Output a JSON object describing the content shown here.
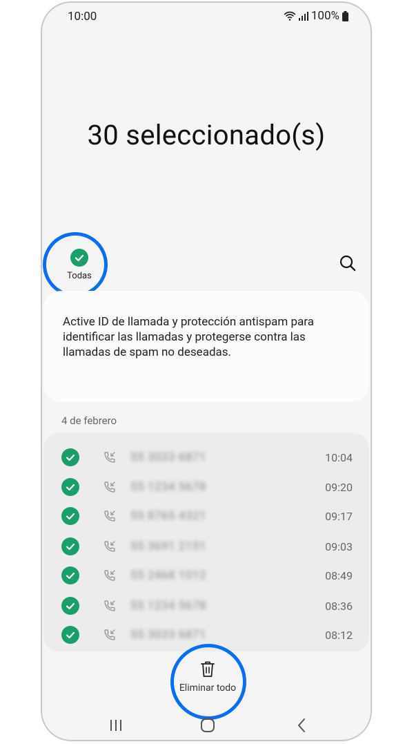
{
  "status_bar": {
    "time": "10:00",
    "battery": "100%"
  },
  "header": {
    "title": "30 seleccionado(s)"
  },
  "toolbar": {
    "select_all_label": "Todas"
  },
  "info_card": {
    "text": "Active ID de llamada y protección antispam para identificar las llamadas y protegerse contra las llamadas de spam no deseadas."
  },
  "call_log": {
    "date_header": "4 de febrero",
    "rows": [
      {
        "number": "55 3033 6871",
        "time": "10:04"
      },
      {
        "number": "55 1234 5678",
        "time": "09:20"
      },
      {
        "number": "55 8765 4321",
        "time": "09:17"
      },
      {
        "number": "55 3691 2151",
        "time": "09:03"
      },
      {
        "number": "55 2468 1012",
        "time": "08:49"
      },
      {
        "number": "55 1234 5678",
        "time": "08:36"
      },
      {
        "number": "55 3033 6871",
        "time": "08:12"
      }
    ]
  },
  "bottom_action": {
    "delete_all_label": "Eliminar todo"
  },
  "colors": {
    "check_green": "#1a9e6a",
    "highlight_blue": "#0a6ef0"
  },
  "icons": {
    "wifi": "wifi-icon",
    "signal": "signal-icon",
    "battery": "battery-icon",
    "search": "search-icon",
    "check": "check-icon",
    "incoming_call": "incoming-call-icon",
    "trash": "trash-icon",
    "recents": "recents-nav-icon",
    "home": "home-nav-icon",
    "back": "back-nav-icon"
  }
}
